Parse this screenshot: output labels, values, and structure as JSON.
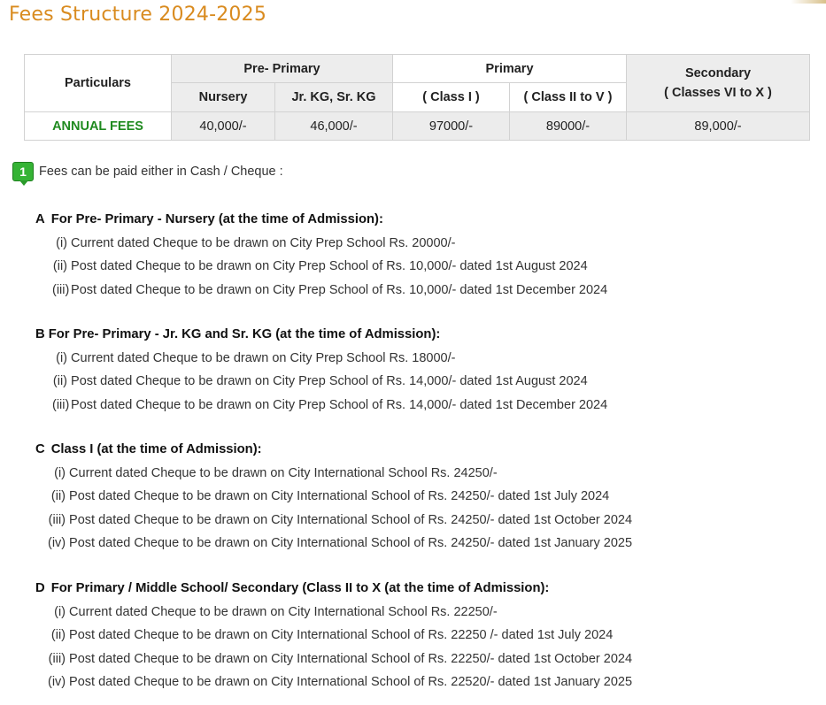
{
  "title": "Fees Structure 2024-2025",
  "table": {
    "particulars_header": "Particulars",
    "groups": {
      "pre_primary": "Pre- Primary",
      "primary": "Primary",
      "secondary_line1": "Secondary",
      "secondary_line2": "( Classes VI to X )"
    },
    "subheaders": {
      "nursery": "Nursery",
      "jrkg_srkg": "Jr. KG, Sr. KG",
      "class1": "( Class I )",
      "class2to5": "( Class II to V )"
    },
    "fee_row": {
      "label": "ANNUAL FEES",
      "values": [
        "40,000/-",
        "46,000/-",
        "97000/-",
        "89000/-",
        "89,000/-"
      ]
    }
  },
  "note": {
    "badge": "1",
    "text": "Fees can be paid either in Cash / Cheque :"
  },
  "sections": [
    {
      "letter": "A",
      "heading": "For Pre- Primary - Nursery (at the time of Admission):",
      "items": [
        {
          "num": "(i)",
          "text": "Current dated Cheque to be drawn on City Prep School Rs. 20000/-"
        },
        {
          "num": "(ii)",
          "text": "Post dated Cheque to be drawn on City Prep School of Rs. 10,000/- dated 1st August 2024"
        },
        {
          "num": "(iii)",
          "text": "Post dated Cheque to be drawn on City Prep School of Rs. 10,000/- dated 1st December 2024"
        }
      ]
    },
    {
      "letter": "B",
      "heading": "For Pre- Primary - Jr. KG and Sr. KG (at the time of Admission):",
      "items": [
        {
          "num": "(i)",
          "text": "Current dated Cheque to be drawn on City Prep School Rs. 18000/-"
        },
        {
          "num": "(ii)",
          "text": "Post dated Cheque to be drawn on City Prep School of Rs. 14,000/- dated 1st August 2024"
        },
        {
          "num": "(iii)",
          "text": "Post dated Cheque to be drawn on City Prep School of Rs. 14,000/- dated 1st December 2024"
        }
      ]
    },
    {
      "letter": "C",
      "heading": "Class I (at the time of Admission):",
      "items": [
        {
          "num": "(i)",
          "text": "Current dated Cheque to be drawn on City International School Rs. 24250/-"
        },
        {
          "num": "(ii)",
          "text": "Post dated Cheque to be drawn on City International School of Rs. 24250/- dated 1st July 2024"
        },
        {
          "num": "(iii)",
          "text": "Post dated Cheque to be drawn on City International School of Rs. 24250/- dated 1st October 2024"
        },
        {
          "num": "(iv)",
          "text": "Post dated Cheque to be drawn on City International School of Rs. 24250/- dated 1st January 2025"
        }
      ]
    },
    {
      "letter": "D",
      "heading": "For Primary / Middle School/ Secondary (Class II to X (at the time of Admission):",
      "items": [
        {
          "num": "(i)",
          "text": "Current dated Cheque to be drawn on City International School Rs. 22250/-"
        },
        {
          "num": "(ii)",
          "text": "Post dated Cheque to be drawn on City International School of Rs. 22250 /- dated 1st July 2024"
        },
        {
          "num": "(iii)",
          "text": "Post dated Cheque to be drawn on City International School of Rs. 22250/- dated 1st October 2024"
        },
        {
          "num": "(iv)",
          "text": "Post dated Cheque to be drawn on City International School of Rs. 22520/- dated 1st January 2025"
        }
      ]
    }
  ],
  "colors": {
    "title": "#d98b1f",
    "fee_label": "#1f8a1f",
    "badge": "#35b335",
    "header_bg": "#ededed"
  }
}
